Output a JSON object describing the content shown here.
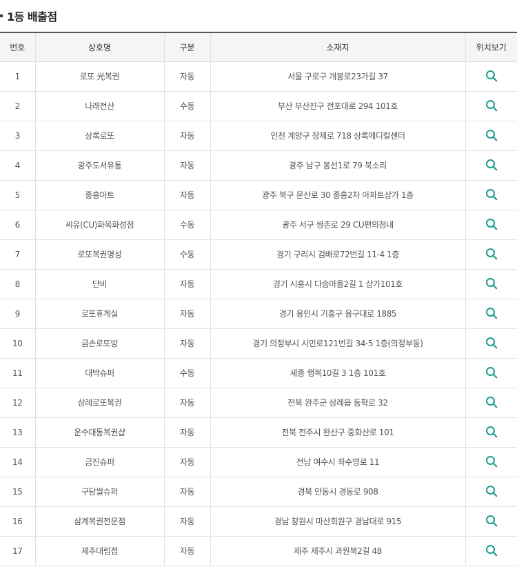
{
  "section_title": "1등 배출점",
  "columns": {
    "no": "번호",
    "name": "상호명",
    "type": "구분",
    "address": "소재지",
    "location": "위치보기"
  },
  "accent_color": "#1a9e8e",
  "rows": [
    {
      "no": "1",
      "name": "로또 光복권",
      "type": "자동",
      "address": "서울 구로구 개봉로23가길 37"
    },
    {
      "no": "2",
      "name": "나래전산",
      "type": "수동",
      "address": "부산 부산진구 전포대로 294 101호"
    },
    {
      "no": "3",
      "name": "상록로또",
      "type": "자동",
      "address": "인천 계양구 장제로 718 상록메디컬센터"
    },
    {
      "no": "4",
      "name": "광주도서유통",
      "type": "자동",
      "address": "광주 남구 봉선1로 79 북소리"
    },
    {
      "no": "5",
      "name": "종흥마트",
      "type": "자동",
      "address": "광주 북구 문산로 30 종흥2차 아파트상가 1층"
    },
    {
      "no": "6",
      "name": "씨유(CU)화목화성점",
      "type": "수동",
      "address": "광주 서구 쌍촌로 29 CU편의점내"
    },
    {
      "no": "7",
      "name": "로또복권명성",
      "type": "수동",
      "address": "경기 구리시 검배로72번길 11-4 1층"
    },
    {
      "no": "8",
      "name": "단비",
      "type": "자동",
      "address": "경기 시흥시 다솜마을2길 1 상가101호"
    },
    {
      "no": "9",
      "name": "로또휴게실",
      "type": "자동",
      "address": "경기 용인시 기흥구 용구대로 1885"
    },
    {
      "no": "10",
      "name": "금손로또방",
      "type": "자동",
      "address": "경기 의정부시 시민로121번길 34-5 1층(의정부동)"
    },
    {
      "no": "11",
      "name": "대박슈퍼",
      "type": "수동",
      "address": "세종 행복10길 3 1층 101호"
    },
    {
      "no": "12",
      "name": "삼례로또복권",
      "type": "자동",
      "address": "전북 완주군 삼례읍 동학로 32"
    },
    {
      "no": "13",
      "name": "운수대통복권샵",
      "type": "자동",
      "address": "전북 전주시 완산구 중화산로 101"
    },
    {
      "no": "14",
      "name": "금진슈퍼",
      "type": "자동",
      "address": "전남 여수시 좌수영로 11"
    },
    {
      "no": "15",
      "name": "구담쌀슈퍼",
      "type": "자동",
      "address": "경북 안동시 경동로 908"
    },
    {
      "no": "16",
      "name": "삼계복권전문점",
      "type": "자동",
      "address": "경남 창원시 마산회원구 경남대로 915"
    },
    {
      "no": "17",
      "name": "제주대림점",
      "type": "자동",
      "address": "제주 제주시 과원북2길 48"
    }
  ]
}
